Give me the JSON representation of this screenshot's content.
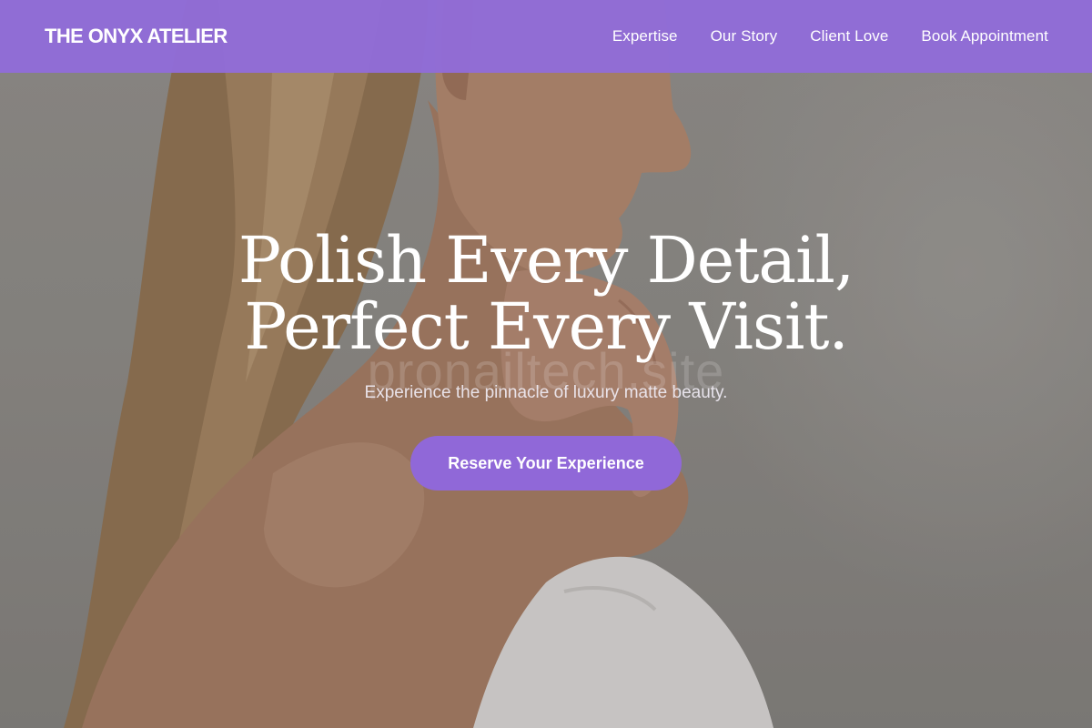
{
  "header": {
    "brand": "THE ONYX ATELIER",
    "nav": [
      {
        "label": "Expertise"
      },
      {
        "label": "Our Story"
      },
      {
        "label": "Client Love"
      },
      {
        "label": "Book Appointment"
      }
    ]
  },
  "hero": {
    "title_line_1": "Polish Every Detail,",
    "title_line_2": "Perfect Every Visit.",
    "watermark": "pronailtech.site",
    "subtitle": "Experience the pinnacle of luxury matte beauty.",
    "cta_label": "Reserve Your Experience",
    "image": "woman-profile-with-towel-photo"
  },
  "colors": {
    "accent": "#9068d8",
    "header_bg": "#916cd8",
    "text": "#ffffff"
  }
}
